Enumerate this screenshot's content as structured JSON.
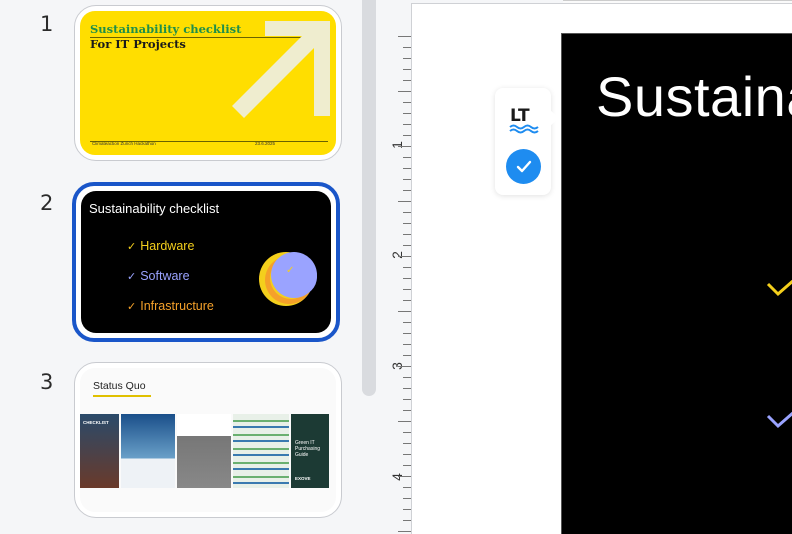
{
  "slides": [
    {
      "number": "1",
      "title": "Sustainability checklist",
      "subtitle": "For IT Projects",
      "footer_left": "Climateaction Zurich Hackathon",
      "footer_right": "23.6.2025",
      "colors": {
        "background": "#ffde00",
        "title": "#1f8f4a",
        "arrow": "#efedcf"
      }
    },
    {
      "number": "2",
      "selected": true,
      "title": "Sustainability checklist",
      "items": [
        {
          "label": "Hardware",
          "color": "#f4cf1c"
        },
        {
          "label": "Software",
          "color": "#9aa3ff"
        },
        {
          "label": "Infrastructure",
          "color": "#f5a12a"
        }
      ]
    },
    {
      "number": "3",
      "title": "Status Quo",
      "image_labels": [
        "CHECKLIST",
        "",
        "",
        "",
        "Green IT Purchasing Guide",
        "EXOVE"
      ]
    }
  ],
  "ruler": {
    "labels": [
      "1",
      "2",
      "3",
      "4"
    ]
  },
  "main_slide": {
    "title": "Sustaina",
    "chevron_colors": [
      "#f4cf1c",
      "#9aa3ff"
    ]
  },
  "languagetool": {
    "logo_text": "LT",
    "status_icon": "check-circle-icon",
    "accent": "#1e8cf0"
  }
}
